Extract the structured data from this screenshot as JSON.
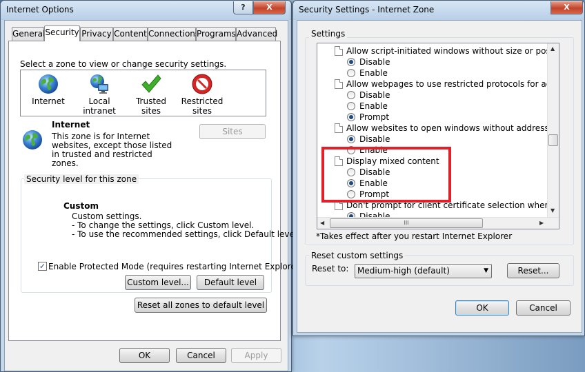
{
  "left_window": {
    "title": "Internet Options",
    "help_glyph": "?",
    "close_glyph": "X",
    "tabs": [
      {
        "label": "General"
      },
      {
        "label": "Security",
        "active": true
      },
      {
        "label": "Privacy"
      },
      {
        "label": "Content"
      },
      {
        "label": "Connections"
      },
      {
        "label": "Programs"
      },
      {
        "label": "Advanced"
      }
    ],
    "zone_prompt": "Select a zone to view or change security settings.",
    "zones": [
      {
        "label": "Internet",
        "icon": "globe-icon"
      },
      {
        "label": "Local intranet",
        "icon": "intranet-icon"
      },
      {
        "label": "Trusted sites",
        "icon": "checkmark-icon"
      },
      {
        "label": "Restricted sites",
        "icon": "restricted-icon"
      }
    ],
    "selected_zone": {
      "title": "Internet",
      "description": "This zone is for Internet websites, except those listed in trusted and restricted zones."
    },
    "sites_button": "Sites",
    "security_level_group": "Security level for this zone",
    "level": {
      "title": "Custom",
      "lines": [
        "Custom settings.",
        "- To change the settings, click Custom level.",
        "- To use the recommended settings, click Default level."
      ]
    },
    "protected_mode": {
      "label": "Enable Protected Mode (requires restarting Internet Explorer)",
      "checked": true
    },
    "custom_level_button": "Custom level...",
    "default_level_button": "Default level",
    "reset_all_button": "Reset all zones to default level",
    "ok_button": "OK",
    "cancel_button": "Cancel",
    "apply_button": "Apply"
  },
  "right_window": {
    "title": "Security Settings - Internet Zone",
    "close_glyph": "X",
    "settings_label": "Settings",
    "tree": [
      {
        "type": "doc",
        "text": "Allow script-initiated windows without size or position constra"
      },
      {
        "type": "radio",
        "text": "Disable",
        "checked": true
      },
      {
        "type": "radio",
        "text": "Enable",
        "checked": false
      },
      {
        "type": "doc",
        "text": "Allow webpages to use restricted protocols for active conten"
      },
      {
        "type": "radio",
        "text": "Disable",
        "checked": false
      },
      {
        "type": "radio",
        "text": "Enable",
        "checked": false
      },
      {
        "type": "radio",
        "text": "Prompt",
        "checked": true
      },
      {
        "type": "doc",
        "text": "Allow websites to open windows without address or status ba"
      },
      {
        "type": "radio",
        "text": "Disable",
        "checked": true
      },
      {
        "type": "radio",
        "text": "Enable",
        "checked": false
      },
      {
        "type": "doc",
        "text": "Display mixed content"
      },
      {
        "type": "radio",
        "text": "Disable",
        "checked": false
      },
      {
        "type": "radio",
        "text": "Enable",
        "checked": true
      },
      {
        "type": "radio",
        "text": "Prompt",
        "checked": false
      },
      {
        "type": "doc",
        "text": "Don't prompt for client certificate selection when only one ce"
      },
      {
        "type": "radio",
        "text": "Disable",
        "checked": true
      }
    ],
    "hscroll_grip": "III",
    "note": "*Takes effect after you restart Internet Explorer",
    "reset_group": "Reset custom settings",
    "reset_to_label": "Reset to:",
    "reset_to_value": "Medium-high (default)",
    "reset_button": "Reset...",
    "ok_button": "OK",
    "cancel_button": "Cancel"
  },
  "colors": {
    "highlight_box": "#e0202a",
    "title_bar": "#c3d6ea",
    "dialog_bg": "#f0f0f0"
  }
}
